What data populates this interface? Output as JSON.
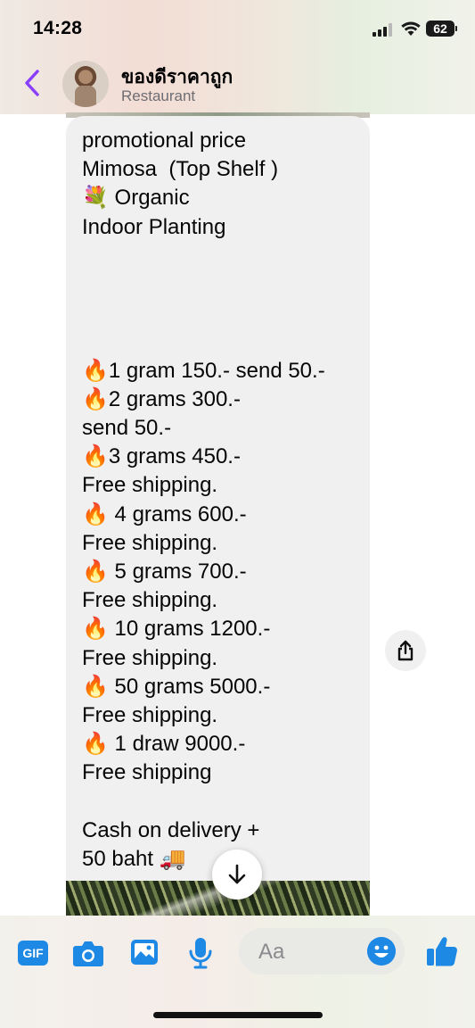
{
  "status_bar": {
    "time": "14:28",
    "battery": "62"
  },
  "header": {
    "contact_name": "ของดีราคาถูก",
    "contact_subtitle": "Restaurant",
    "back_icon": "chevron-left-icon"
  },
  "message": {
    "text": "promotional price\nMimosa  (Top Shelf )\n💐 Organic\nIndoor Planting\n\n\n\n\n🔥1 gram 150.- send 50.-\n🔥2 grams 300.-\nsend 50.-\n🔥3 grams 450.-\nFree shipping.\n🔥 4 grams 600.-\nFree shipping.\n🔥 5 grams 700.-\nFree shipping.\n🔥 10 grams 1200.-\nFree shipping.\n🔥 50 grams 5000.-\nFree shipping.\n🔥 1 draw 9000.-\nFree shipping\n\nCash on delivery +\n50 baht 🚚"
  },
  "composer": {
    "gif_label": "GIF",
    "placeholder": "Aa"
  },
  "colors": {
    "accent": "#1e88e5",
    "back_arrow": "#8a3ffc",
    "bubble": "#f0f0f0"
  }
}
